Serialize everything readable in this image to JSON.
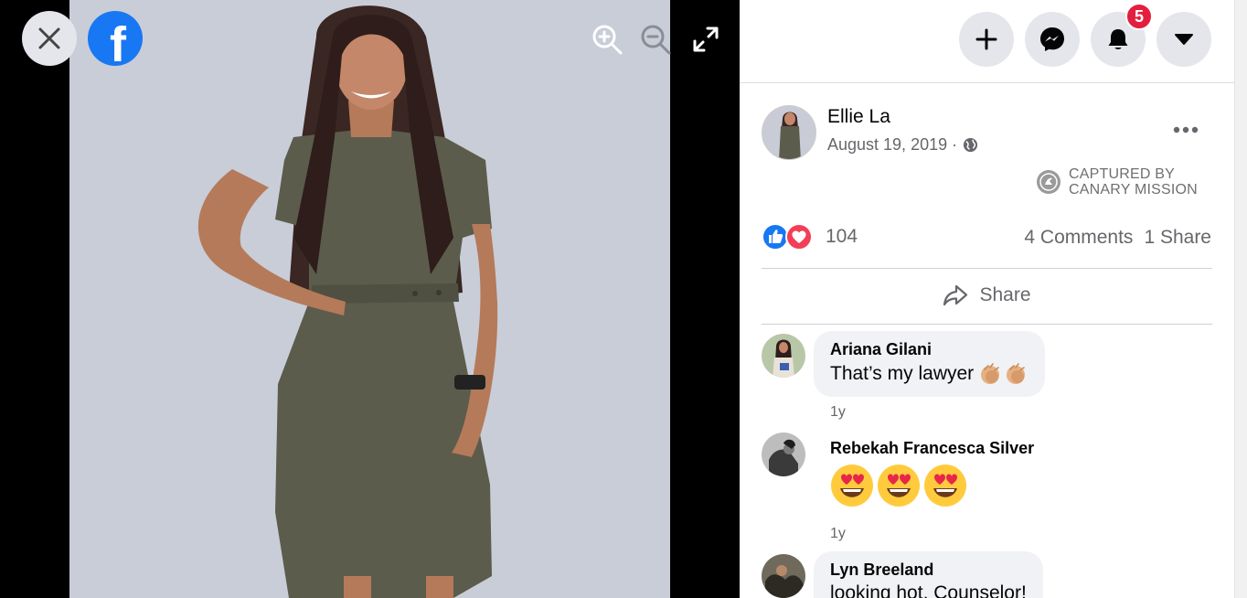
{
  "post": {
    "author": "Ellie La",
    "date": "August 19, 2019 ·",
    "watermark_line1": "CAPTURED BY",
    "watermark_line2": "CANARY MISSION",
    "reaction_count": "104",
    "comments_count": "4 Comments",
    "shares_count": "1 Share",
    "share_label": "Share"
  },
  "topbar": {
    "notification_count": "5"
  },
  "comments": [
    {
      "name": "Ariana Gilani",
      "text": "That’s my lawyer",
      "time": "1y"
    },
    {
      "name": "Rebekah Francesca Silver",
      "text": "",
      "time": "1y"
    },
    {
      "name": "Lyn Breeland",
      "text": "looking hot, Counselor!"
    }
  ],
  "icons": {
    "close": "close-icon",
    "brand": "facebook-logo",
    "zoom_in": "zoom-in-icon",
    "zoom_out": "zoom-out-icon",
    "fullscreen": "fullscreen-icon",
    "create": "plus-icon",
    "messenger": "messenger-icon",
    "notifications": "bell-icon",
    "account": "caret-down-icon",
    "privacy": "globe-icon",
    "more": "more-icon",
    "like": "like-icon",
    "love": "love-icon",
    "share": "share-icon"
  },
  "colors": {
    "brand": "#1877f2",
    "badge": "#e41e3f",
    "love": "#f33e58",
    "photo_background": "#c8cdd8"
  }
}
